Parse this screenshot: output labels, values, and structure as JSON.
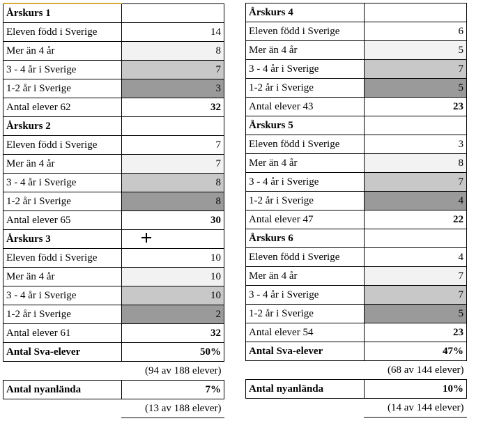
{
  "labels": {
    "row0": "Eleven född i Sverige",
    "row1": "Mer än 4 år",
    "row2": "3 - 4 år i Sverige",
    "row3": "1-2 år i Sverige",
    "sva": "Antal Sva-elever",
    "nyan": "Antal nyanlända"
  },
  "left": {
    "groups": [
      {
        "title": "Årskurs 1",
        "values": [
          14,
          8,
          7,
          3
        ],
        "totalLabel": "Antal elever 62",
        "total": 32
      },
      {
        "title": "Årskurs 2",
        "values": [
          7,
          7,
          8,
          8
        ],
        "totalLabel": "Antal elever 65",
        "total": 30
      },
      {
        "title": "Årskurs 3",
        "values": [
          10,
          10,
          10,
          2
        ],
        "totalLabel": "Antal elever 61",
        "total": 32
      }
    ],
    "svaPct": "50%",
    "svaNote": "(94 av 188 elever)",
    "nyanPct": "7%",
    "nyanNote": "(13 av 188 elever)"
  },
  "right": {
    "groups": [
      {
        "title": "Årskurs 4",
        "values": [
          6,
          5,
          7,
          5
        ],
        "totalLabel": "Antal elever 43",
        "total": 23
      },
      {
        "title": "Årskurs 5",
        "values": [
          3,
          8,
          7,
          4
        ],
        "totalLabel": "Antal elever 47",
        "total": 22
      },
      {
        "title": "Årskurs 6",
        "values": [
          4,
          7,
          7,
          5
        ],
        "totalLabel": "Antal elever 54",
        "total": 23
      }
    ],
    "svaPct": "47%",
    "svaNote": "(68 av 144 elever)",
    "nyanPct": "10%",
    "nyanNote": "(14 av 144 elever)"
  }
}
